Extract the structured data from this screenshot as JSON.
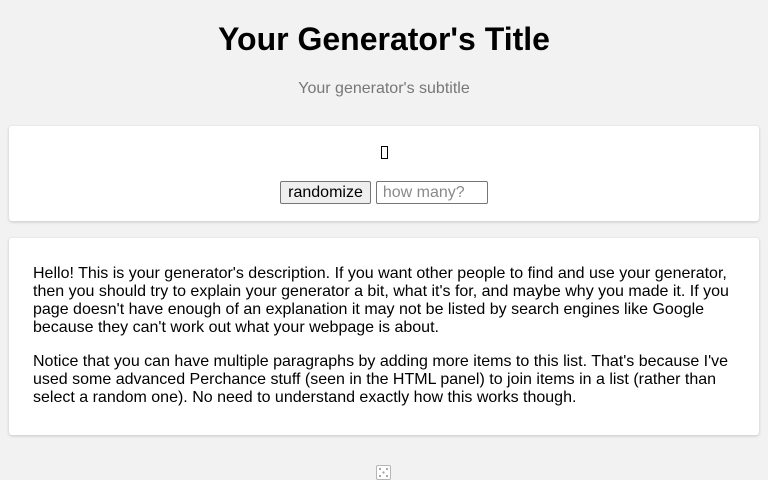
{
  "header": {
    "title": "Your Generator's Title",
    "subtitle": "Your generator's subtitle"
  },
  "output": {
    "value": ""
  },
  "controls": {
    "randomize_label": "randomize",
    "count_placeholder": "how many?"
  },
  "description": {
    "paragraphs": [
      "Hello! This is your generator's description. If you want other people to find and use your generator, then you should try to explain your generator a bit, what it's for, and maybe why you made it. If you page doesn't have enough of an explanation it may not be listed by search engines like Google because they can't work out what your webpage is about.",
      "Notice that you can have multiple paragraphs by adding more items to this list. That's because I've used some advanced Perchance stuff (seen in the HTML panel) to join items in a list (rather than select a random one). No need to understand exactly how this works though."
    ]
  },
  "footer": {
    "icon": "dice-icon"
  },
  "colors": {
    "background": "#f2f2f2",
    "card": "#ffffff",
    "subtitle_text": "#777777"
  }
}
